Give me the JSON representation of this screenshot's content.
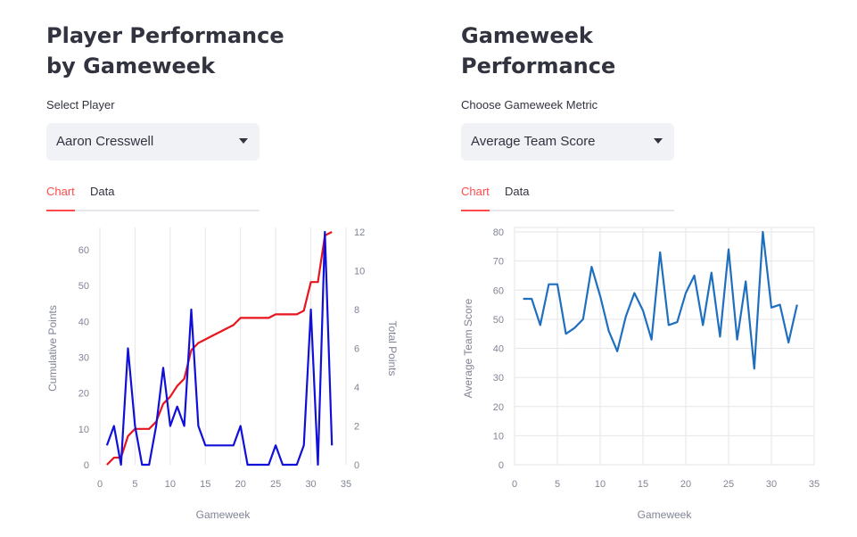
{
  "left": {
    "title_line1": "Player Performance",
    "title_line2": "by Gameweek",
    "select_label": "Select Player",
    "select_value": "Aaron Cresswell",
    "tabs": [
      "Chart",
      "Data"
    ]
  },
  "right": {
    "title_line1": "Gameweek",
    "title_line2": "Performance",
    "select_label": "Choose Gameweek Metric",
    "select_value": "Average Team Score",
    "tabs": [
      "Chart",
      "Data"
    ]
  },
  "icons": {
    "select_caret": "chevron-down-icon"
  },
  "colors": {
    "accent": "#ff4b4b",
    "cumulative": "#e8141e",
    "total": "#1010d8",
    "team": "#1f6fbf"
  },
  "chart_data": [
    {
      "type": "line",
      "title": "",
      "xlabel": "Gameweek",
      "ylabel": "Cumulative Points",
      "y2label": "Total Points",
      "xlim": [
        0,
        35
      ],
      "ylim": [
        0,
        65
      ],
      "y2lim": [
        0,
        12
      ],
      "xticks": [
        "0",
        "5",
        "10",
        "15",
        "20",
        "25",
        "30",
        "35"
      ],
      "yticks": [
        "0",
        "10",
        "20",
        "30",
        "40",
        "50",
        "60"
      ],
      "y2ticks": [
        "0",
        "2",
        "4",
        "6",
        "8",
        "10",
        "12"
      ],
      "series": [
        {
          "axis": "left",
          "color": "#e8141e",
          "x": [
            1,
            2,
            3,
            4,
            5,
            6,
            7,
            8,
            9,
            10,
            11,
            12,
            13,
            14,
            15,
            16,
            17,
            18,
            19,
            20,
            21,
            22,
            23,
            24,
            25,
            26,
            27,
            28,
            29,
            30,
            31,
            32,
            33
          ],
          "values": [
            0,
            2,
            2,
            8,
            10,
            10,
            10,
            12,
            17,
            19,
            22,
            24,
            32,
            34,
            35,
            36,
            37,
            38,
            39,
            41,
            41,
            41,
            41,
            41,
            42,
            42,
            42,
            42,
            43,
            51,
            51,
            64,
            65
          ]
        },
        {
          "axis": "right",
          "color": "#1010d8",
          "x": [
            1,
            2,
            3,
            4,
            5,
            6,
            7,
            8,
            9,
            10,
            11,
            12,
            13,
            14,
            15,
            16,
            17,
            18,
            19,
            20,
            21,
            22,
            23,
            24,
            25,
            26,
            27,
            28,
            29,
            30,
            31,
            32,
            33
          ],
          "values": [
            1,
            2,
            0,
            6,
            2,
            0,
            0,
            2,
            5,
            2,
            3,
            2,
            8,
            2,
            1,
            1,
            1,
            1,
            1,
            2,
            0,
            0,
            0,
            0,
            1,
            0,
            0,
            0,
            1,
            8,
            0,
            12,
            1
          ]
        }
      ]
    },
    {
      "type": "line",
      "title": "",
      "xlabel": "Gameweek",
      "ylabel": "Average Team Score",
      "xlim": [
        0,
        35
      ],
      "ylim": [
        0,
        80
      ],
      "xticks": [
        "0",
        "5",
        "10",
        "15",
        "20",
        "25",
        "30",
        "35"
      ],
      "yticks": [
        "0",
        "10",
        "20",
        "30",
        "40",
        "50",
        "60",
        "70",
        "80"
      ],
      "series": [
        {
          "color": "#1f6fbf",
          "x": [
            1,
            2,
            3,
            4,
            5,
            6,
            7,
            8,
            9,
            10,
            11,
            12,
            13,
            14,
            15,
            16,
            17,
            18,
            19,
            20,
            21,
            22,
            23,
            24,
            25,
            26,
            27,
            28,
            29,
            30,
            31,
            32,
            33
          ],
          "values": [
            57,
            57,
            48,
            62,
            62,
            45,
            47,
            50,
            68,
            58,
            46,
            39,
            51,
            59,
            53,
            43,
            73,
            48,
            49,
            59,
            65,
            48,
            66,
            44,
            74,
            43,
            63,
            33,
            80,
            54,
            55,
            42,
            55
          ]
        }
      ]
    }
  ]
}
